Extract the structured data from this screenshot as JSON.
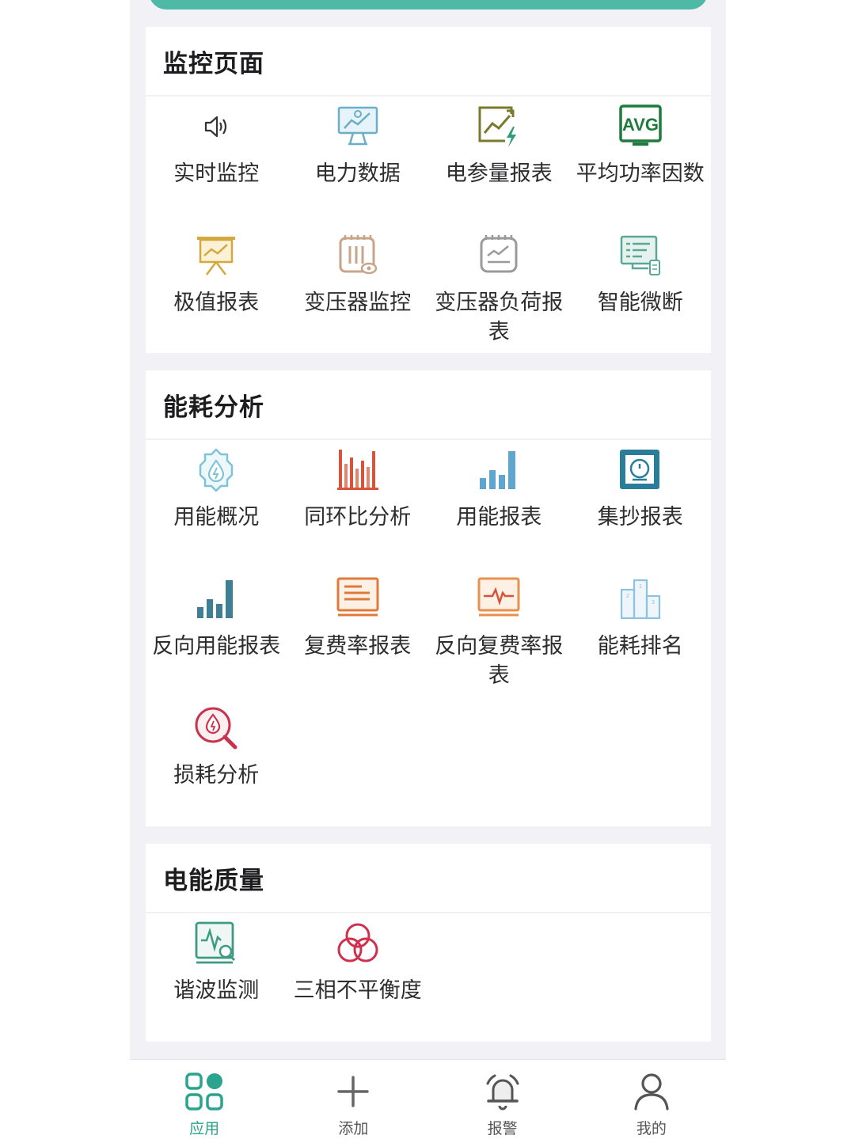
{
  "sections": [
    {
      "title": "监控页面",
      "items": [
        {
          "label": "实时监控",
          "icon": "speaker-icon"
        },
        {
          "label": "电力数据",
          "icon": "monitor-chart-icon"
        },
        {
          "label": "电参量报表",
          "icon": "trend-bolt-icon"
        },
        {
          "label": "平均功率因数",
          "icon": "avg-icon"
        },
        {
          "label": "极值报表",
          "icon": "presentation-board-icon"
        },
        {
          "label": "变压器监控",
          "icon": "transformer-eye-icon"
        },
        {
          "label": "变压器负荷报表",
          "icon": "transformer-load-icon"
        },
        {
          "label": "智能微断",
          "icon": "smart-breaker-icon"
        }
      ]
    },
    {
      "title": "能耗分析",
      "items": [
        {
          "label": "用能概况",
          "icon": "energy-gear-drop-icon"
        },
        {
          "label": "同环比分析",
          "icon": "comparison-bars-icon"
        },
        {
          "label": "用能报表",
          "icon": "energy-bars-icon"
        },
        {
          "label": "集抄报表",
          "icon": "meter-reading-icon"
        },
        {
          "label": "反向用能报表",
          "icon": "reverse-bars-icon"
        },
        {
          "label": "复费率报表",
          "icon": "rate-report-icon"
        },
        {
          "label": "反向复费率报表",
          "icon": "pulse-screen-icon"
        },
        {
          "label": "能耗排名",
          "icon": "podium-icon"
        },
        {
          "label": "损耗分析",
          "icon": "loss-search-icon"
        }
      ]
    },
    {
      "title": "电能质量",
      "items": [
        {
          "label": "谐波监测",
          "icon": "harmonic-search-icon"
        },
        {
          "label": "三相不平衡度",
          "icon": "three-circles-icon"
        }
      ]
    }
  ],
  "tabbar": [
    {
      "label": "应用",
      "icon": "apps-icon",
      "active": true
    },
    {
      "label": "添加",
      "icon": "plus-icon",
      "active": false
    },
    {
      "label": "报警",
      "icon": "bell-icon",
      "active": false
    },
    {
      "label": "我的",
      "icon": "user-icon",
      "active": false
    }
  ]
}
